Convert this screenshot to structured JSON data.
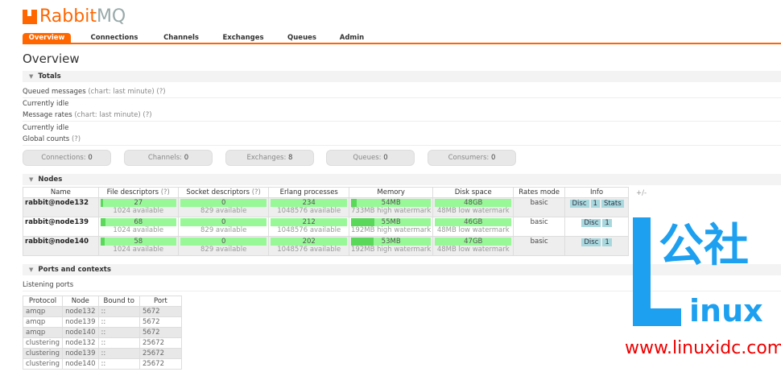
{
  "app": {
    "logo_text_1": "Rabbit",
    "logo_text_2": "MQ"
  },
  "nav": [
    "Overview",
    "Connections",
    "Channels",
    "Exchanges",
    "Queues",
    "Admin"
  ],
  "page_title": "Overview",
  "totals": {
    "title": "Totals",
    "queued": "Queued messages",
    "chart_hint": "(chart: last minute)",
    "help": "(?)",
    "idle1": "Currently idle",
    "rates": "Message rates",
    "idle2": "Currently idle",
    "global": "Global counts",
    "counts": [
      {
        "label": "Connections:",
        "value": "0"
      },
      {
        "label": "Channels:",
        "value": "0"
      },
      {
        "label": "Exchanges:",
        "value": "8"
      },
      {
        "label": "Queues:",
        "value": "0"
      },
      {
        "label": "Consumers:",
        "value": "0"
      }
    ]
  },
  "nodes": {
    "title": "Nodes",
    "plusminus": "+/-",
    "help": "(?)",
    "headers": [
      "Name",
      "File descriptors",
      "Socket descriptors",
      "Erlang processes",
      "Memory",
      "Disk space",
      "Rates mode",
      "Info"
    ],
    "rows": [
      {
        "name": "rabbit@node132",
        "fd": "27",
        "fd_avail": "1024 available",
        "fd_pct": 3,
        "sd": "0",
        "sd_avail": "829 available",
        "ep": "234",
        "ep_avail": "1048576 available",
        "mem": "54MB",
        "mem_wm": "733MB high watermark",
        "mem_pct": 7,
        "disk": "48GB",
        "disk_wm": "48MB low watermark",
        "rates": "basic",
        "info": [
          "Disc",
          "1",
          "Stats"
        ]
      },
      {
        "name": "rabbit@node139",
        "fd": "68",
        "fd_avail": "1024 available",
        "fd_pct": 7,
        "sd": "0",
        "sd_avail": "829 available",
        "ep": "212",
        "ep_avail": "1048576 available",
        "mem": "55MB",
        "mem_wm": "192MB high watermark",
        "mem_pct": 29,
        "disk": "46GB",
        "disk_wm": "48MB low watermark",
        "rates": "basic",
        "info": [
          "Disc",
          "1"
        ]
      },
      {
        "name": "rabbit@node140",
        "fd": "58",
        "fd_avail": "1024 available",
        "fd_pct": 6,
        "sd": "0",
        "sd_avail": "829 available",
        "ep": "202",
        "ep_avail": "1048576 available",
        "mem": "53MB",
        "mem_wm": "192MB high watermark",
        "mem_pct": 28,
        "disk": "47GB",
        "disk_wm": "48MB low watermark",
        "rates": "basic",
        "info": [
          "Disc",
          "1"
        ]
      }
    ]
  },
  "ports": {
    "title": "Ports and contexts",
    "listening": "Listening ports",
    "headers": [
      "Protocol",
      "Node",
      "Bound to",
      "Port"
    ],
    "rows": [
      [
        "amqp",
        "node132",
        "::",
        "5672"
      ],
      [
        "amqp",
        "node139",
        "::",
        "5672"
      ],
      [
        "amqp",
        "node140",
        "::",
        "5672"
      ],
      [
        "clustering",
        "node132",
        "::",
        "25672"
      ],
      [
        "clustering",
        "node139",
        "::",
        "25672"
      ],
      [
        "clustering",
        "node140",
        "::",
        "25672"
      ]
    ]
  },
  "watermark": {
    "cn": "公社",
    "l": "L",
    "inux": "inux",
    "url": "www.linuxidc.com"
  }
}
